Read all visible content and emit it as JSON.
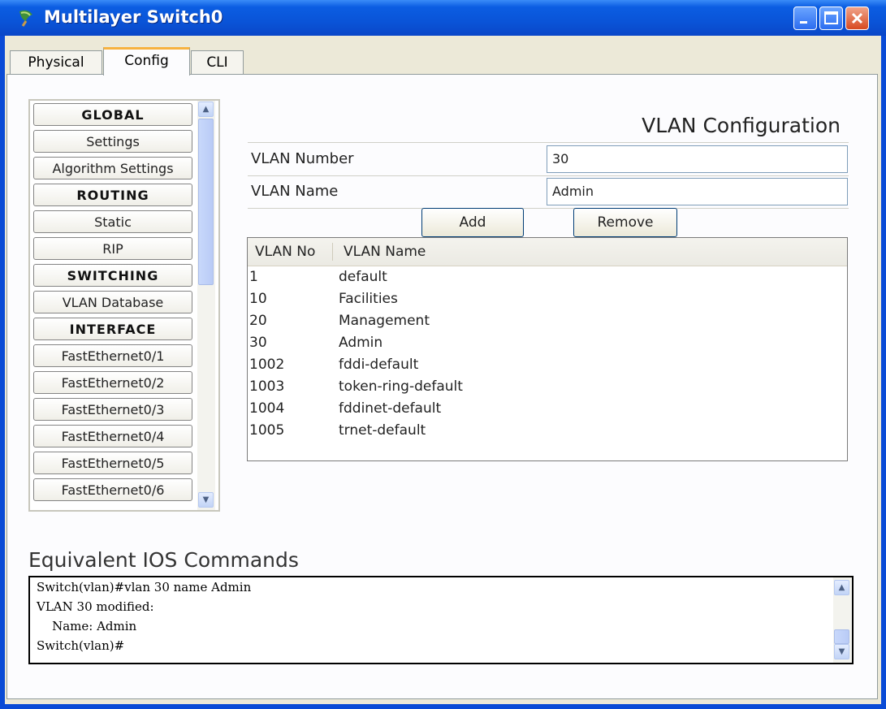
{
  "window": {
    "title": "Multilayer Switch0"
  },
  "tabs": [
    {
      "label": "Physical"
    },
    {
      "label": "Config"
    },
    {
      "label": "CLI"
    }
  ],
  "sidebar": {
    "items": [
      {
        "label": "GLOBAL",
        "header": true
      },
      {
        "label": "Settings"
      },
      {
        "label": "Algorithm Settings"
      },
      {
        "label": "ROUTING",
        "header": true
      },
      {
        "label": "Static"
      },
      {
        "label": "RIP"
      },
      {
        "label": "SWITCHING",
        "header": true
      },
      {
        "label": "VLAN Database"
      },
      {
        "label": "INTERFACE",
        "header": true
      },
      {
        "label": "FastEthernet0/1"
      },
      {
        "label": "FastEthernet0/2"
      },
      {
        "label": "FastEthernet0/3"
      },
      {
        "label": "FastEthernet0/4"
      },
      {
        "label": "FastEthernet0/5"
      },
      {
        "label": "FastEthernet0/6"
      }
    ]
  },
  "vlan_config": {
    "title": "VLAN Configuration",
    "number_label": "VLAN Number",
    "number_value": "30",
    "name_label": "VLAN Name",
    "name_value": "Admin",
    "add_label": "Add",
    "remove_label": "Remove",
    "columns": [
      "VLAN No",
      "VLAN Name"
    ],
    "rows": [
      {
        "no": "1",
        "name": "default"
      },
      {
        "no": "10",
        "name": "Facilities"
      },
      {
        "no": "20",
        "name": "Management"
      },
      {
        "no": "30",
        "name": "Admin"
      },
      {
        "no": "1002",
        "name": "fddi-default"
      },
      {
        "no": "1003",
        "name": "token-ring-default"
      },
      {
        "no": "1004",
        "name": "fddinet-default"
      },
      {
        "no": "1005",
        "name": "trnet-default"
      }
    ]
  },
  "ios": {
    "title": "Equivalent IOS Commands",
    "lines": [
      "Switch(vlan)#vlan 30 name Admin",
      "VLAN 30 modified:",
      "    Name: Admin",
      "Switch(vlan)#"
    ]
  }
}
